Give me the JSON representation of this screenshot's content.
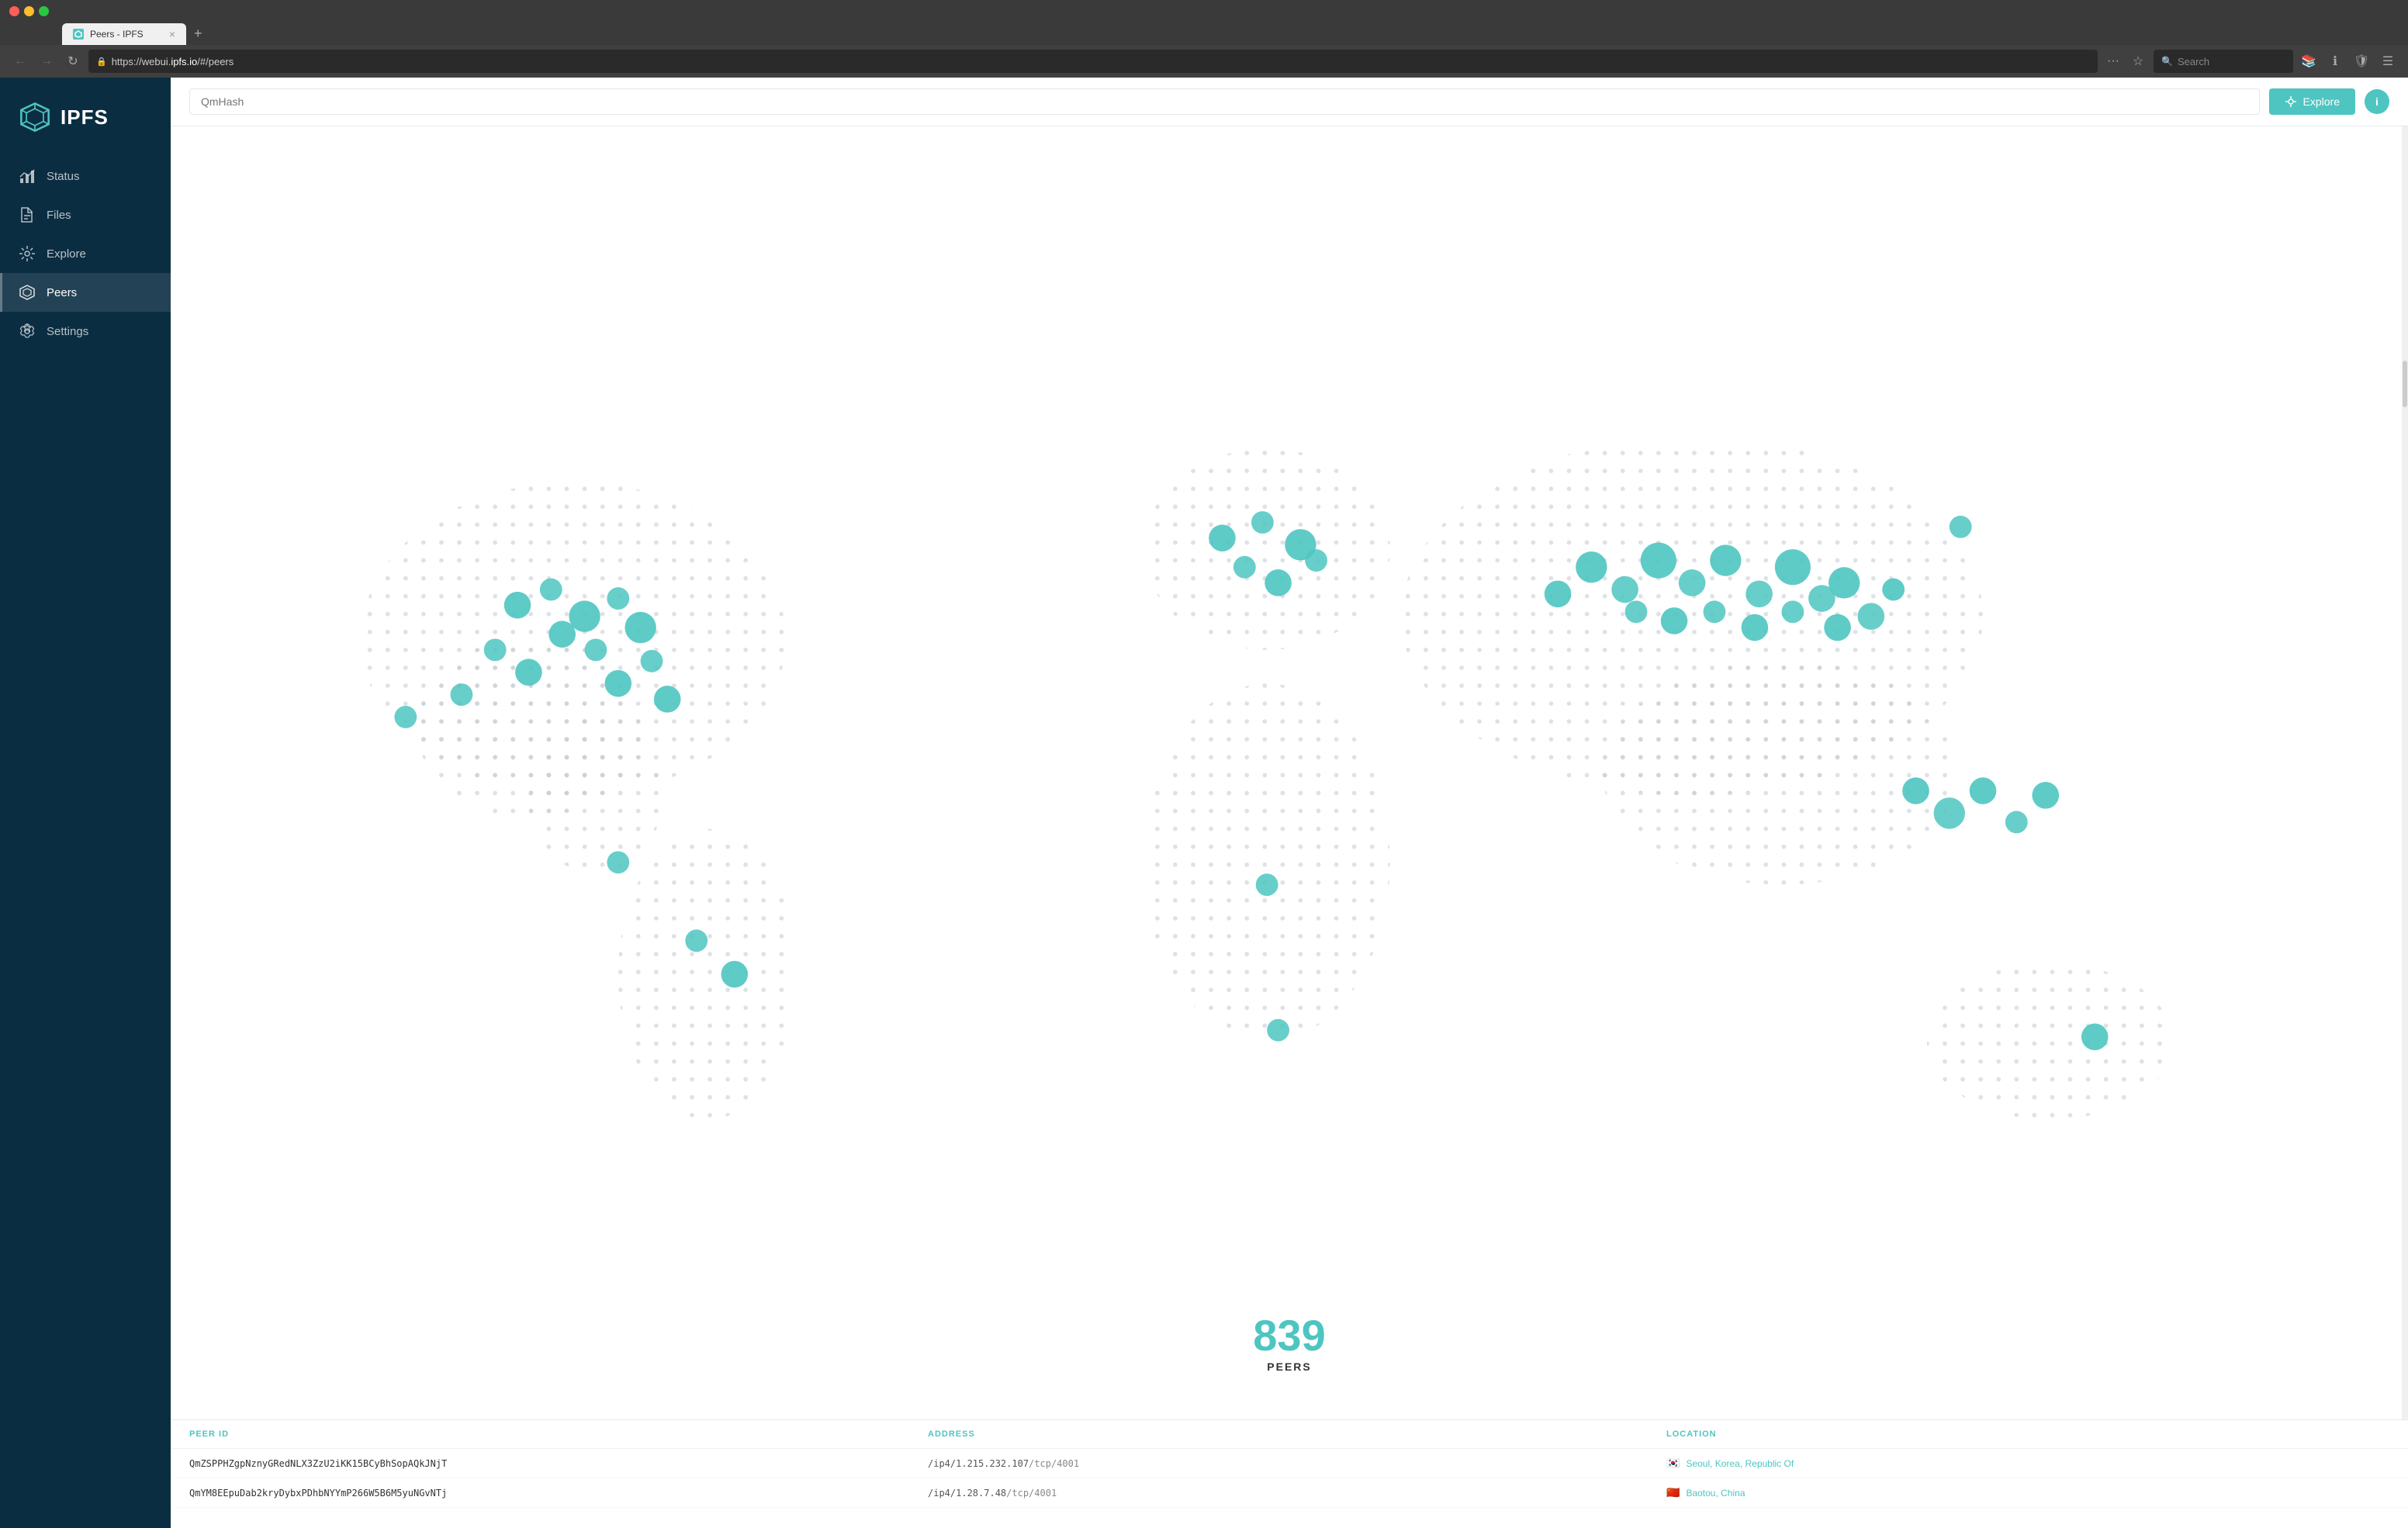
{
  "browser": {
    "tab_title": "Peers - IPFS",
    "tab_close": "×",
    "tab_new": "+",
    "url": "https://webui.ipfs.io/#/peers",
    "url_protocol": "https://webui.",
    "url_domain": "ipfs.io",
    "url_path": "/#/peers",
    "search_placeholder": "Search",
    "nav_back": "←",
    "nav_forward": "→",
    "nav_refresh": "↻"
  },
  "topbar": {
    "qmhash_placeholder": "QmHash",
    "explore_label": "Explore",
    "info_label": "i"
  },
  "sidebar": {
    "logo_text": "IPFS",
    "items": [
      {
        "id": "status",
        "label": "Status",
        "active": false
      },
      {
        "id": "files",
        "label": "Files",
        "active": false
      },
      {
        "id": "explore",
        "label": "Explore",
        "active": false
      },
      {
        "id": "peers",
        "label": "Peers",
        "active": true
      },
      {
        "id": "settings",
        "label": "Settings",
        "active": false
      }
    ]
  },
  "map": {
    "peer_count": "839",
    "peers_label": "PEERS"
  },
  "table": {
    "columns": [
      {
        "id": "peer_id",
        "label": "PEER ID"
      },
      {
        "id": "address",
        "label": "ADDRESS"
      },
      {
        "id": "location",
        "label": "LOCATION"
      }
    ],
    "rows": [
      {
        "peer_id": "QmZSPPHZgpNznyGRedNLX3ZzU2iKK15BCyBhSopAQkJNjT",
        "address_prefix": "/ip4/1.215.232.107",
        "address_suffix": "/tcp/4001",
        "flag": "🇰🇷",
        "location": "Seoul, Korea, Republic Of"
      },
      {
        "peer_id": "QmYM8EEpuDab2kryDybxPDhbNYYmP266W5B6M5yuNGvNTj",
        "address_prefix": "/ip4/1.28.7.48",
        "address_suffix": "/tcp/4001",
        "flag": "🇨🇳",
        "location": "Baotou, China"
      }
    ]
  }
}
